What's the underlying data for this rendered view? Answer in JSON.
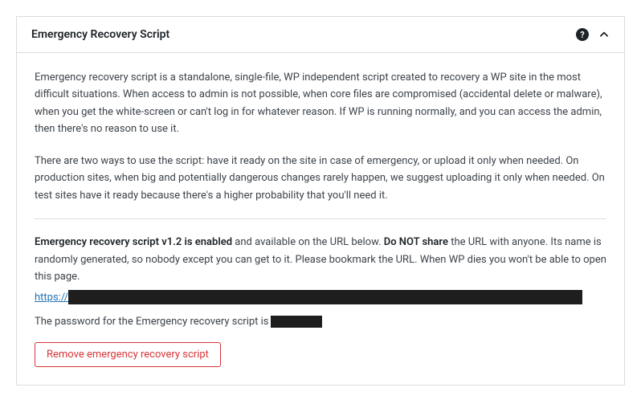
{
  "header": {
    "title": "Emergency Recovery Script"
  },
  "body": {
    "para1": "Emergency recovery script is a standalone, single-file, WP independent script created to recovery a WP site in the most difficult situations. When access to admin is not possible, when core files are compromised (accidental delete or malware), when you get the white-screen or can't log in for whatever reason. If WP is running normally, and you can access the admin, then there's no reason to use it.",
    "para2": "There are two ways to use the script: have it ready on the site in case of emergency, or upload it only when needed. On production sites, when big and potentially dangerous changes rarely happen, we suggest uploading it only when needed. On test sites have it ready because there's a higher probability that you'll need it.",
    "status": {
      "bold1": "Emergency recovery script v1.2 is enabled",
      "mid1": " and available on the URL below. ",
      "bold2": "Do NOT share",
      "mid2": " the URL with anyone. Its name is randomly generated, so nobody except you can get to it. Please bookmark the URL. When WP dies you won't be able to open this page."
    },
    "url_prefix": "https://",
    "password_label": "The password for the Emergency recovery script is ",
    "remove_button": "Remove emergency recovery script"
  }
}
